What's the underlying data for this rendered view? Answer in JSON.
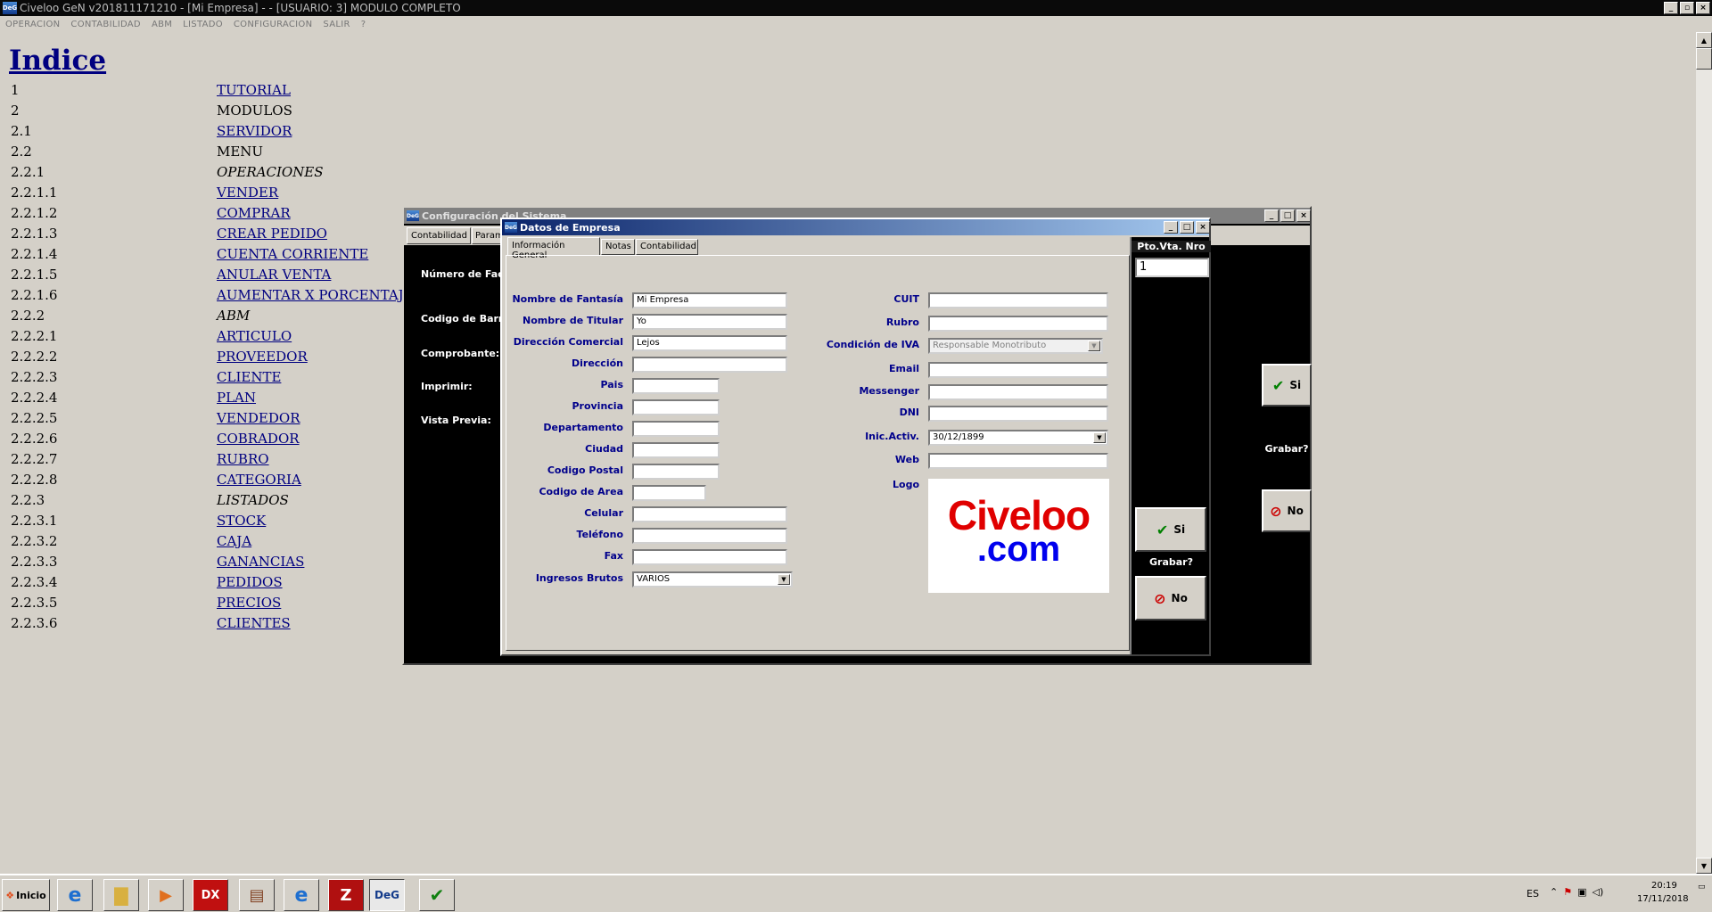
{
  "app": {
    "title": "Civeloo GeN v201811171210 - [Mi Empresa] -  - [USUARIO: 3] MODULO COMPLETO",
    "icon": "deg-logo-icon"
  },
  "menu": [
    "OPERACION",
    "CONTABILIDAD",
    "ABM",
    "LISTADO",
    "CONFIGURACION",
    "SALIR",
    "?"
  ],
  "index": {
    "title": "Indice",
    "items": [
      {
        "num": "1",
        "label": "TUTORIAL",
        "style": "link"
      },
      {
        "num": "2",
        "label": "MODULOS",
        "style": "plain"
      },
      {
        "num": "2.1",
        "label": "SERVIDOR",
        "style": "link"
      },
      {
        "num": "2.2",
        "label": "MENU",
        "style": "plain"
      },
      {
        "num": "2.2.1",
        "label": "OPERACIONES",
        "style": "ital"
      },
      {
        "num": "2.2.1.1",
        "label": "VENDER",
        "style": "link"
      },
      {
        "num": "2.2.1.2",
        "label": "COMPRAR",
        "style": "link"
      },
      {
        "num": "2.2.1.3",
        "label": "CREAR PEDIDO",
        "style": "link"
      },
      {
        "num": "2.2.1.4",
        "label": "CUENTA CORRIENTE",
        "style": "link"
      },
      {
        "num": "2.2.1.5",
        "label": "ANULAR VENTA",
        "style": "link"
      },
      {
        "num": "2.2.1.6",
        "label": "AUMENTAR X PORCENTAJ",
        "style": "link"
      },
      {
        "num": "2.2.2",
        "label": "ABM",
        "style": "ital"
      },
      {
        "num": "2.2.2.1",
        "label": "ARTICULO",
        "style": "link"
      },
      {
        "num": "2.2.2.2",
        "label": "PROVEEDOR",
        "style": "link"
      },
      {
        "num": "2.2.2.3",
        "label": "CLIENTE",
        "style": "link"
      },
      {
        "num": "2.2.2.4",
        "label": "PLAN",
        "style": "link"
      },
      {
        "num": "2.2.2.5",
        "label": "VENDEDOR",
        "style": "link"
      },
      {
        "num": "2.2.2.6",
        "label": "COBRADOR",
        "style": "link"
      },
      {
        "num": "2.2.2.7",
        "label": "RUBRO",
        "style": "link"
      },
      {
        "num": "2.2.2.8",
        "label": "CATEGORIA",
        "style": "link"
      },
      {
        "num": "2.2.3",
        "label": "LISTADOS",
        "style": "ital"
      },
      {
        "num": "2.2.3.1",
        "label": "STOCK",
        "style": "link"
      },
      {
        "num": "2.2.3.2",
        "label": "CAJA",
        "style": "link"
      },
      {
        "num": "2.2.3.3",
        "label": "GANANCIAS",
        "style": "link"
      },
      {
        "num": "2.2.3.4",
        "label": "PEDIDOS",
        "style": "link"
      },
      {
        "num": "2.2.3.5",
        "label": "PRECIOS",
        "style": "link"
      },
      {
        "num": "2.2.3.6",
        "label": "CLIENTES",
        "style": "link"
      }
    ]
  },
  "config_window": {
    "title": "Configuración del Sistema",
    "tabs": [
      "Contabilidad",
      "Param"
    ],
    "labels": [
      "Número de Fact",
      "Codigo de Barra",
      "Comprobante:",
      "Imprimir:",
      "Vista Previa:"
    ],
    "side_si": "Si",
    "side_grabar": "Grabar?",
    "side_no": "No"
  },
  "empresa_dialog": {
    "title": "Datos de Empresa",
    "tabs": [
      "Información General",
      "Notas",
      "Contabilidad"
    ],
    "left_fields": [
      {
        "label": "Nombre de Fantasía",
        "value": "Mi Empresa"
      },
      {
        "label": "Nombre de Titular",
        "value": "Yo"
      },
      {
        "label": "Dirección Comercial",
        "value": "Lejos"
      },
      {
        "label": "Dirección",
        "value": ""
      },
      {
        "label": "Pais",
        "value": ""
      },
      {
        "label": "Provincia",
        "value": ""
      },
      {
        "label": "Departamento",
        "value": ""
      },
      {
        "label": "Ciudad",
        "value": ""
      },
      {
        "label": "Codigo Postal",
        "value": ""
      },
      {
        "label": "Codigo de Area",
        "value": ""
      },
      {
        "label": "Celular",
        "value": ""
      },
      {
        "label": "Teléfono",
        "value": ""
      },
      {
        "label": "Fax",
        "value": ""
      },
      {
        "label": "Ingresos Brutos",
        "value": "VARIOS"
      }
    ],
    "right_fields": [
      {
        "label": "CUIT",
        "value": ""
      },
      {
        "label": "Rubro",
        "value": ""
      },
      {
        "label": "Condición de IVA",
        "value": "Responsable Monotributo"
      },
      {
        "label": "Email",
        "value": ""
      },
      {
        "label": "Messenger",
        "value": ""
      },
      {
        "label": "DNI",
        "value": ""
      },
      {
        "label": "Inic.Activ.",
        "value": "30/12/1899"
      },
      {
        "label": "Web",
        "value": ""
      },
      {
        "label": "Logo",
        "value": ""
      }
    ],
    "logo_text_top": "Civeloo",
    "logo_text_bottom": ".com",
    "side": {
      "pto_label": "Pto.Vta. Nro",
      "pto_value": "1",
      "si": "Si",
      "grabar": "Grabar?",
      "no": "No"
    }
  },
  "taskbar": {
    "start": "Inicio",
    "lang": "ES",
    "time": "20:19",
    "date": "17/11/2018",
    "items": [
      "ie-icon",
      "folder-icon",
      "media-player-icon",
      "dx-icon",
      "archive-icon",
      "ie-alt-icon",
      "filezilla-icon",
      "deg-icon",
      "vim-icon"
    ]
  },
  "colors": {
    "accent": "#000080",
    "red": "#cc0000",
    "logo_blue": "#0000ff"
  }
}
